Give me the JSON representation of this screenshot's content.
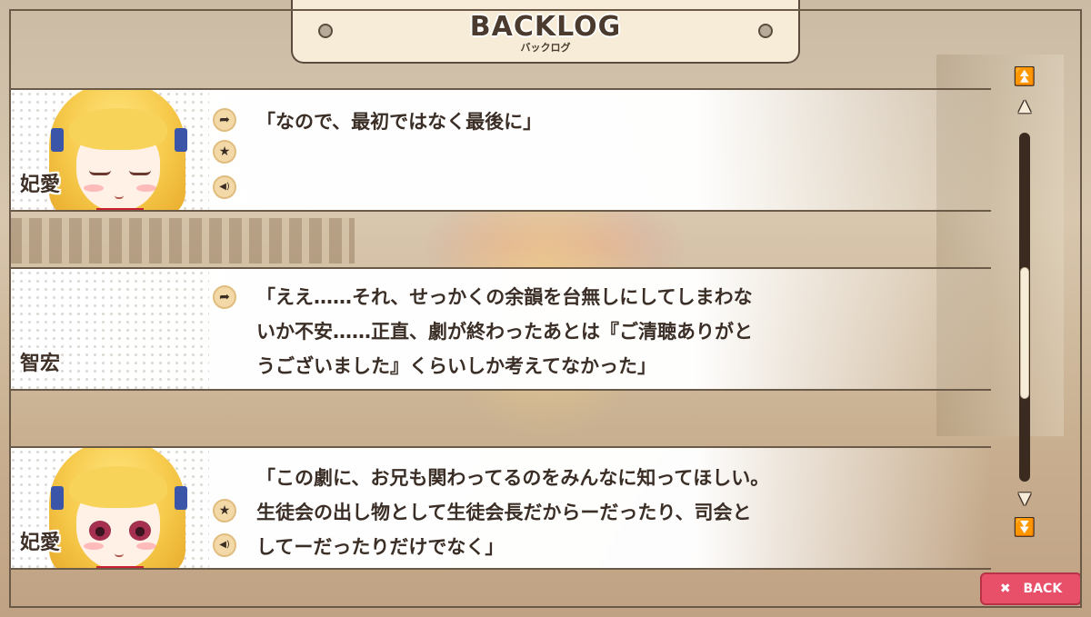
{
  "header": {
    "title": "BACKLOG",
    "subtitle": "バックログ"
  },
  "entries": [
    {
      "speaker": "妃愛",
      "text": "「なので、最初ではなく最後に」",
      "portrait": "eyes-closed",
      "buttons": [
        "jump-icon",
        "favorite-star-icon",
        "voice-replay-icon"
      ]
    },
    {
      "speaker": "智宏",
      "text": "「ええ……それ、せっかくの余韻を台無しにしてしまわな\nいか不安……正直、劇が終わったあとは『ご清聴ありがと\nうございました』くらいしか考えてなかった」",
      "portrait": "none",
      "buttons": [
        "jump-icon"
      ]
    },
    {
      "speaker": "妃愛",
      "text": "「この劇に、お兄も関わってるのをみんなに知ってほしい。\n生徒会の出し物として生徒会長だからーだったり、司会と\nしてーだったりだけでなく」",
      "portrait": "eyes-open",
      "buttons": [
        "favorite-star-icon",
        "voice-replay-icon"
      ]
    }
  ],
  "icons": {
    "jump": "➦",
    "star": "★",
    "voice": "◀)",
    "page_top": "⏫",
    "scroll_up": "▲",
    "scroll_down": "▼",
    "page_bottom": "⏬",
    "close": "✖"
  },
  "scrollbar": {
    "position_fraction": 0.62,
    "thumb_fraction": 0.38
  },
  "back_button": {
    "label": "BACK"
  },
  "colors": {
    "frame": "#f4e9d4",
    "outline": "#6b5a48",
    "back_button": "#e8506a",
    "icon_button": "#f3d9a8"
  }
}
